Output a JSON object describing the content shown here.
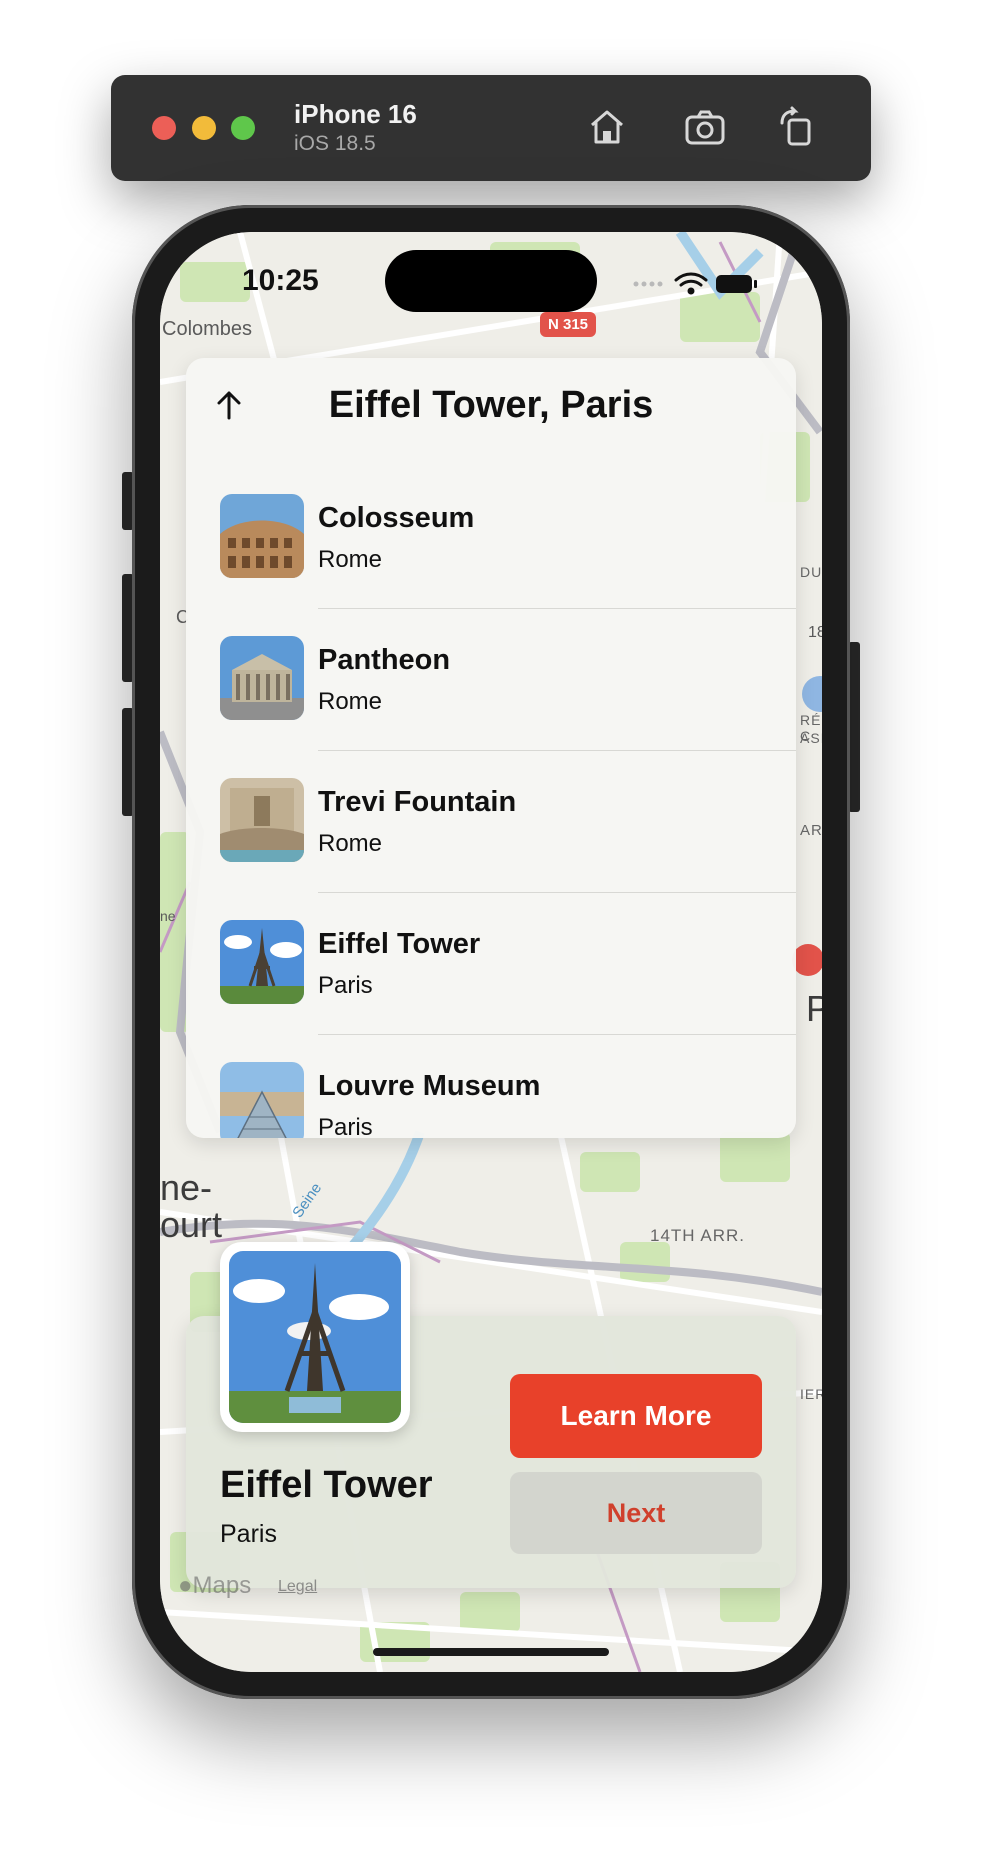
{
  "simulator": {
    "device": "iPhone 16",
    "os": "iOS 18.5",
    "buttons": [
      "home-icon",
      "screenshot-icon",
      "rotate-icon"
    ]
  },
  "status": {
    "time": "10:25"
  },
  "map": {
    "labels": {
      "colombes": "Colombes",
      "road": "N 315",
      "arr14": "14TH ARR.",
      "ne": "ne-",
      "ourt": "ourt",
      "seine": "Seine",
      "sacre": "RÉ-C",
      "basil": "ASILI",
      "arr": "ARR",
      "num18": "18",
      "dul": "DUL",
      "left_c": "C",
      "ne_small": "ne",
      "right_p": "P",
      "ier": "IER"
    },
    "brand": "Maps",
    "legal": "Legal"
  },
  "list": {
    "title": "Eiffel Tower, Paris",
    "items": [
      {
        "title": "Colosseum",
        "subtitle": "Rome"
      },
      {
        "title": "Pantheon",
        "subtitle": "Rome"
      },
      {
        "title": "Trevi Fountain",
        "subtitle": "Rome"
      },
      {
        "title": "Eiffel Tower",
        "subtitle": "Paris"
      },
      {
        "title": "Louvre Museum",
        "subtitle": "Paris"
      }
    ]
  },
  "detail": {
    "title": "Eiffel Tower",
    "subtitle": "Paris",
    "learn_more": "Learn More",
    "next": "Next"
  },
  "colors": {
    "accent": "#e8412a",
    "next_text": "#d0402c"
  }
}
